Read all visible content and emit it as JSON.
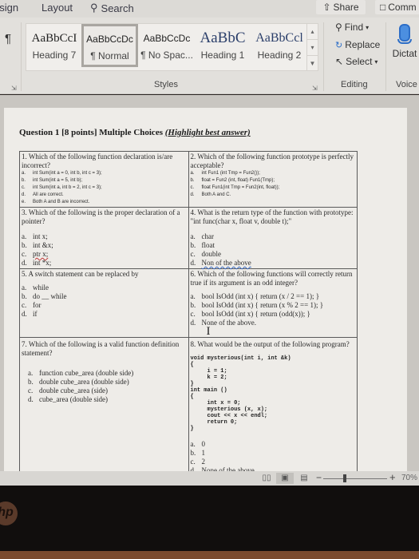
{
  "ribbon": {
    "tabs": [
      {
        "label": "esign"
      },
      {
        "label": "Layout"
      },
      {
        "label": "Search"
      }
    ],
    "share_label": "Share",
    "comments_label": "Comm",
    "styles": [
      {
        "preview": "AaBbCcI",
        "label": "Heading 7",
        "selected": false
      },
      {
        "preview": "AaBbCcDc",
        "label": "¶ Normal",
        "selected": true
      },
      {
        "preview": "AaBbCcDc",
        "label": "¶ No Spac...",
        "selected": false
      },
      {
        "preview": "AaBbC",
        "label": "Heading 1",
        "selected": false
      },
      {
        "preview": "AaBbCcl",
        "label": "Heading 2",
        "selected": false
      }
    ],
    "groups": {
      "styles": "Styles",
      "editing": "Editing",
      "voice": "Voice"
    },
    "editing": {
      "find": "Find",
      "replace": "Replace",
      "select": "Select"
    },
    "dictate_label": "Dictat"
  },
  "document": {
    "heading": "Question 1 [8 points] Multiple Choices ",
    "heading_instruction": "(Highlight best answer)",
    "questions": [
      {
        "number": "1.",
        "text": "Which of the following function declaration is/are incorrect?",
        "options": [
          {
            "key": "a.",
            "text": "int Sum(int a = 0, int b, int c = 3);"
          },
          {
            "key": "b.",
            "text": "int Sum(int a = 5, int b);"
          },
          {
            "key": "c.",
            "text": "int Sum(int a, int b = 2, int c = 3);"
          },
          {
            "key": "d.",
            "text": "All are correct."
          },
          {
            "key": "e.",
            "text": "Both A and B are incorrect."
          }
        ]
      },
      {
        "number": "2.",
        "text": "Which of the following function prototype is perfectly acceptable?",
        "options": [
          {
            "key": "a.",
            "text": "int Fun1 (int Tmp = Fun2());"
          },
          {
            "key": "b.",
            "text": "float = Fun2 (int, float) Fun1(Tmp);"
          },
          {
            "key": "c.",
            "text": "float Fun1(int Tmp = Fun2(int, float));"
          },
          {
            "key": "d.",
            "text": "Both A and C."
          }
        ]
      },
      {
        "number": "3.",
        "text": "Which of the following is the proper declaration of a pointer?",
        "options": [
          {
            "key": "a.",
            "text": "int x;"
          },
          {
            "key": "b.",
            "text": "int &x;"
          },
          {
            "key": "c.",
            "text": "ptr x;"
          },
          {
            "key": "d.",
            "text": "int *x;"
          }
        ]
      },
      {
        "number": "4.",
        "text": "What is the return type of the function with prototype: \"int func(char x, float v, double t);\"",
        "options": [
          {
            "key": "a.",
            "text": "char"
          },
          {
            "key": "b.",
            "text": "float"
          },
          {
            "key": "c.",
            "text": "double"
          },
          {
            "key": "d.",
            "text": "Non of the above"
          }
        ]
      },
      {
        "number": "5.",
        "text": "A switch statement can be replaced by",
        "options": [
          {
            "key": "a.",
            "text": "while"
          },
          {
            "key": "b.",
            "text": "do __ while"
          },
          {
            "key": "c.",
            "text": "for"
          },
          {
            "key": "d.",
            "text": "if"
          }
        ]
      },
      {
        "number": "6.",
        "text": "Which of the following functions will correctly return true if its argument is an odd integer?",
        "options": [
          {
            "key": "a.",
            "text": "bool IsOdd (int x) { return (x / 2 == 1); }"
          },
          {
            "key": "b.",
            "text": "bool IsOdd (int x) { return (x % 2 == 1); }"
          },
          {
            "key": "c.",
            "text": "bool IsOdd (int x) { return (odd(x)); }"
          },
          {
            "key": "d.",
            "text": "None of the above."
          }
        ]
      },
      {
        "number": "7.",
        "text": "Which of the following is a valid function definition statement?",
        "options": [
          {
            "key": "a.",
            "text": "function cube_area (double side)"
          },
          {
            "key": "b.",
            "text": "double cube_area (double side)"
          },
          {
            "key": "c.",
            "text": "double cube_area (side)"
          },
          {
            "key": "d.",
            "text": "cube_area (double side)"
          }
        ]
      },
      {
        "number": "8.",
        "text": "What would be the output of the following program?",
        "code": "void mysterious(int i, int &k)\n{\n     i = 1;\n     k = 2;\n}\nint main ()\n{\n     int x = 0;\n     mysterious (x, x);\n     cout << x << endl;\n     return 0;\n}",
        "options": [
          {
            "key": "a.",
            "text": "0"
          },
          {
            "key": "b.",
            "text": "1"
          },
          {
            "key": "c.",
            "text": "2"
          },
          {
            "key": "d.",
            "text": "None of the above"
          }
        ]
      }
    ]
  },
  "statusbar": {
    "zoom_percent": "70%",
    "zoom_value": 70
  },
  "hardware": {
    "brand": "hp"
  }
}
